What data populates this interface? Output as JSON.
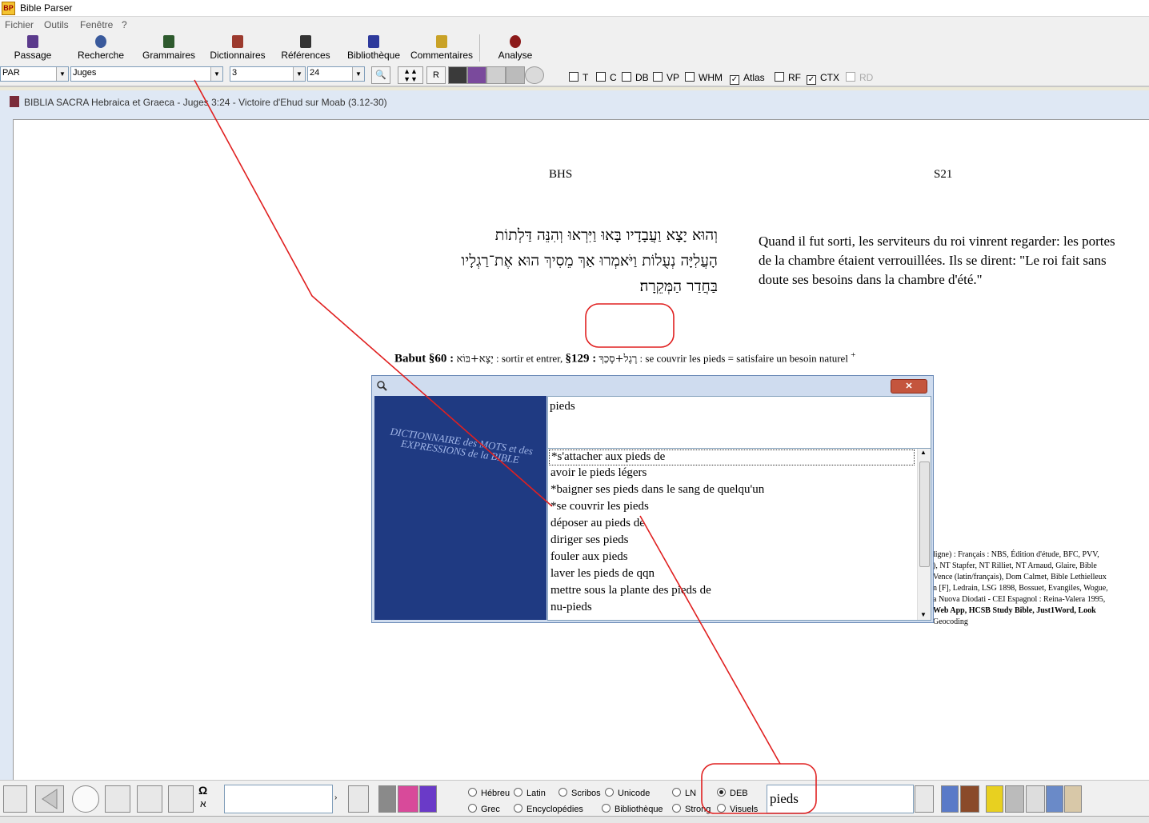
{
  "app": {
    "title": "Bible Parser",
    "icon_text": "BP"
  },
  "menu": {
    "items": [
      "Fichier",
      "Outils",
      "Fenêtre",
      "?"
    ]
  },
  "toolbar": {
    "buttons": [
      {
        "label": "Passage",
        "icon": "book-icon",
        "color": "#5b3a8c"
      },
      {
        "label": "Recherche",
        "icon": "search-icon",
        "color": "#3a5a9c"
      },
      {
        "label": "Grammaires",
        "icon": "books-icon",
        "color": "#2e5a2e"
      },
      {
        "label": "Dictionnaires",
        "icon": "dictionary-icon",
        "color": "#9c3a2e"
      },
      {
        "label": "Références",
        "icon": "references-icon",
        "color": "#333333"
      },
      {
        "label": "Bibliothèque",
        "icon": "library-icon",
        "color": "#2e3a9c"
      },
      {
        "label": "Commentaires",
        "icon": "commentary-icon",
        "color": "#c9a227"
      },
      {
        "label": "Analyse",
        "icon": "analyze-icon",
        "color": "#8c1a1a"
      }
    ]
  },
  "selectors": {
    "version": "PAR",
    "book": "Juges",
    "chapter": "3",
    "verse": "24",
    "r_button": "R"
  },
  "checkboxes": [
    {
      "label": "T",
      "checked": false
    },
    {
      "label": "C",
      "checked": false
    },
    {
      "label": "DB",
      "checked": false
    },
    {
      "label": "VP",
      "checked": false
    },
    {
      "label": "WHM",
      "checked": false
    },
    {
      "label": "Atlas",
      "checked": true
    },
    {
      "label": "RF",
      "checked": false
    },
    {
      "label": "CTX",
      "checked": true
    },
    {
      "label": "RD",
      "checked": false
    }
  ],
  "document": {
    "window_title": "BIBLIA SACRA Hebraica et Graeca - Juges 3:24 - Victoire d'Ehud sur Moab (3.12-30)",
    "col_left_head": "BHS",
    "col_right_head": "S21",
    "hebrew_lines": [
      "וְהוּא יָצָא וַעֲבָדָיו בָּאוּ וַיִּרְאוּ וְהִנֵּה דַּלְתוֹת",
      "הָעֲלִיָּה נְעֻלוֹת וַיֹּאמְרוּ אַךְ מֵסִיךְ הוּא אֶת־רַגְלָיו",
      "בַּחֲדַר הַמְּקֵרָה׃"
    ],
    "french_text": "Quand il fut sorti, les serviteurs du roi vinrent regarder: les portes de la chambre étaient verrouillées. Ils se dirent: \"Le roi fait sans doute ses besoins dans la chambre d'été.\"",
    "babut_label": "Babut §60 :",
    "babut_hebrew_1": "יָצָא+בּוֹא",
    "babut_text_1": ": sortir et entrer,",
    "babut_ref_2": "§129 :",
    "babut_hebrew_2": "רֶגֶל+סָכַךְ",
    "babut_text_2": ": se couvrir les pieds = satisfaire un besoin naturel",
    "babut_plus": "+",
    "right_notes": [
      "ligne) : Français : NBS, Édition d'étude, BFC, PVV,",
      "), NT Stapfer, NT Rilliet, NT Arnaud, Glaire, Bible",
      "Vence (latin/français), Dom Calmet, Bible Lethielleux",
      "n [F], Ledrain, LSG 1898, Bossuet, Evangiles, Wogue,",
      "a Nuova Diodati - CEI Espagnol : Reina-Valera 1995,",
      "Web App, HCSB Study Bible, Just1Word, Look",
      "Geocoding"
    ]
  },
  "dialog": {
    "book_cover_text": "DICTIONNAIRE des MOTS et des EXPRESSIONS de la BIBLE",
    "close_label": "✕",
    "query": "pieds",
    "results": [
      "*s'attacher aux pieds de",
      "avoir le pieds légers",
      "*baigner ses pieds dans le sang de quelqu'un",
      "*se couvrir les pieds",
      "déposer au pieds de",
      "diriger ses pieds",
      "fouler aux pieds",
      "laver les pieds de qqn",
      "mettre sous la plante des pieds de",
      "nu-pieds"
    ]
  },
  "bottom": {
    "radios": [
      {
        "label": "Hébreu",
        "checked": false
      },
      {
        "label": "Latin",
        "checked": false
      },
      {
        "label": "Scribos",
        "checked": false
      },
      {
        "label": "Unicode",
        "checked": false
      },
      {
        "label": "LN",
        "checked": false
      },
      {
        "label": "DEB",
        "checked": true
      },
      {
        "label": "Grec",
        "checked": false
      },
      {
        "label": "Encyclopédies",
        "checked": false
      },
      {
        "label": "Bibliothèque",
        "checked": false
      },
      {
        "label": "Strong",
        "checked": false
      },
      {
        "label": "Visuels",
        "checked": false
      }
    ],
    "search_value": "pieds",
    "omega": "Ω",
    "aleph": "א",
    "colors": {
      "annotation": "#e02020",
      "accent": "#1f3a82"
    }
  }
}
